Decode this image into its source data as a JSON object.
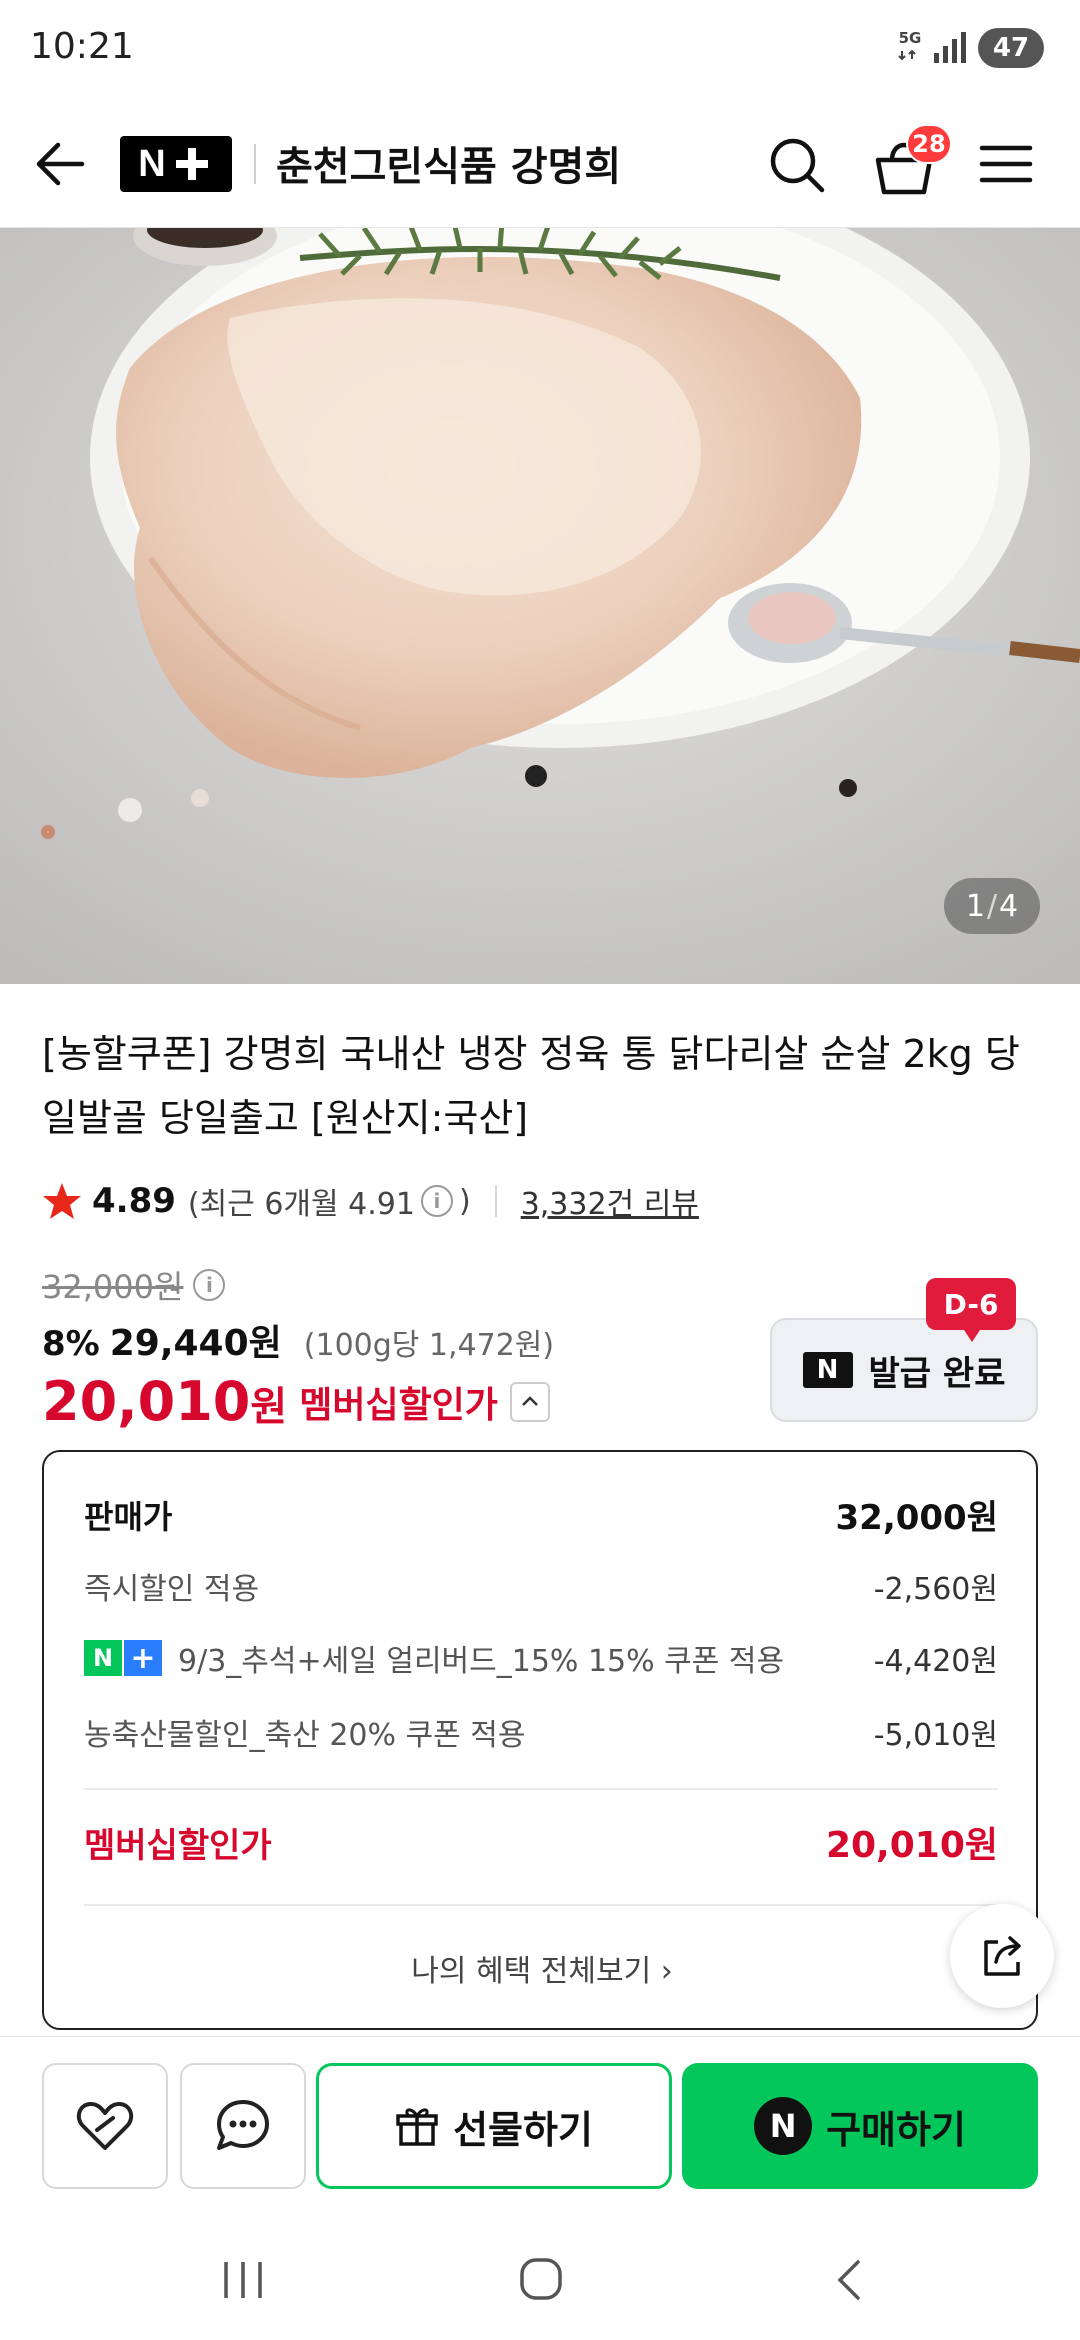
{
  "status": {
    "time": "10:21",
    "network": "5G",
    "battery": "47"
  },
  "header": {
    "logo_text": "N",
    "store_name": "춘천그린식품 강명희",
    "cart_count": "28"
  },
  "hero": {
    "current_index": "1",
    "total": "4"
  },
  "product": {
    "title": "[농할쿠폰] 강명희 국내산 냉장 정육 통 닭다리살 순살 2kg 당일발골 당일출고 [원산지:국산]",
    "rating": "4.89",
    "rating_recent": "(최근 6개월 4.91",
    "rating_recent_close": ")",
    "review_count": "3,332건 리뷰",
    "original_price": "32,000원",
    "discount_rate": "8%",
    "sale_price": "29,440원",
    "unit_price": "(100g당 1,472원)",
    "member_price_number": "20,010",
    "member_price_unit": "원",
    "member_label": "멤버십할인가"
  },
  "coupon": {
    "badge": "D-6",
    "icon_text": "N",
    "label": "발급 완료"
  },
  "breakdown": {
    "rows": [
      {
        "label": "판매가",
        "value": "32,000원"
      },
      {
        "label": "즉시할인 적용",
        "value": "-2,560원"
      },
      {
        "label": "9/3_추석+세일 얼리버드_15% 15% 쿠폰 적용",
        "value": "-4,420원"
      },
      {
        "label": "농축산물할인_축산 20% 쿠폰 적용",
        "value": "-5,010원"
      }
    ],
    "total_label": "멤버십할인가",
    "total_value": "20,010원",
    "view_all": "나의 혜택 전체보기 ›",
    "np_n": "N",
    "np_plus": "+"
  },
  "actions": {
    "gift": "선물하기",
    "buy": "구매하기",
    "buy_icon": "N"
  },
  "colors": {
    "naver_green": "#03c75a",
    "member_red": "#d6082d",
    "cart_badge": "#ff3b3b"
  }
}
